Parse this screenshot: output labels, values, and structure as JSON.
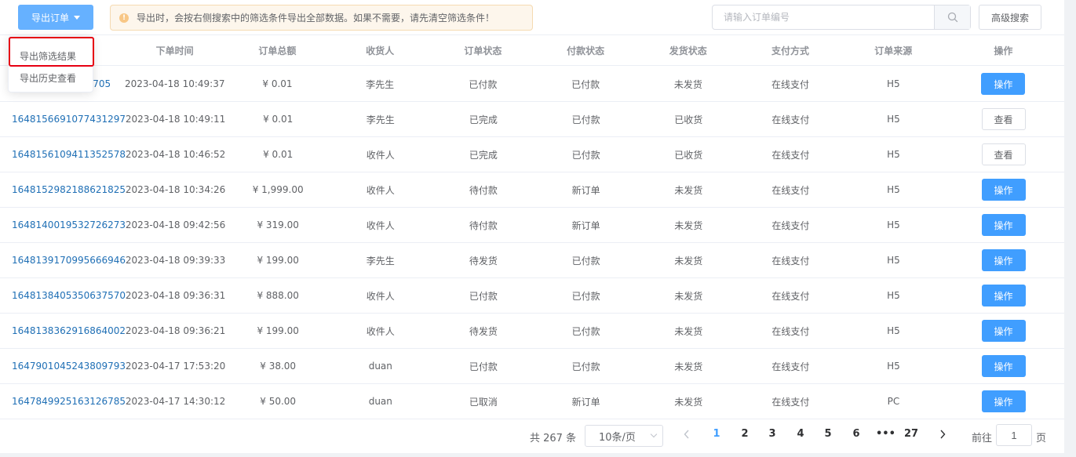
{
  "toolbar": {
    "export_label": "导出订单",
    "alert_icon": "!",
    "alert_text": "导出时，会按右侧搜索中的筛选条件导出全部数据。如果不需要，请先清空筛选条件！",
    "search_placeholder": "请输入订单编号",
    "search_value": "",
    "advanced_label": "高级搜索"
  },
  "dropdown": {
    "items": [
      {
        "label": "导出筛选结果"
      },
      {
        "label": "导出历史查看"
      }
    ],
    "highlight_color": "#e60012"
  },
  "table": {
    "headers": [
      "下单时间",
      "订单总额",
      "收货人",
      "订单状态",
      "付款状态",
      "发货状态",
      "支付方式",
      "订单来源",
      "操作"
    ],
    "rows": [
      {
        "order": "1648157...6705",
        "order_visible": "6705",
        "time": "2023-04-18 10:49:37",
        "amount": "¥ 0.01",
        "receiver": "李先生",
        "status": "已付款",
        "pay": "已付款",
        "ship": "未发货",
        "method": "在线支付",
        "source": "H5",
        "action": "操作"
      },
      {
        "order": "1648156691077431297",
        "time": "2023-04-18 10:49:11",
        "amount": "¥ 0.01",
        "receiver": "李先生",
        "status": "已完成",
        "pay": "已付款",
        "ship": "已收货",
        "method": "在线支付",
        "source": "H5",
        "action": "查看"
      },
      {
        "order": "1648156109411352578",
        "time": "2023-04-18 10:46:52",
        "amount": "¥ 0.01",
        "receiver": "收件人",
        "status": "已完成",
        "pay": "已付款",
        "ship": "已收货",
        "method": "在线支付",
        "source": "H5",
        "action": "查看"
      },
      {
        "order": "1648152982188621825",
        "time": "2023-04-18 10:34:26",
        "amount": "¥ 1,999.00",
        "receiver": "收件人",
        "status": "待付款",
        "pay": "新订单",
        "ship": "未发货",
        "method": "在线支付",
        "source": "H5",
        "action": "操作"
      },
      {
        "order": "1648140019532726273",
        "time": "2023-04-18 09:42:56",
        "amount": "¥ 319.00",
        "receiver": "收件人",
        "status": "待付款",
        "pay": "新订单",
        "ship": "未发货",
        "method": "在线支付",
        "source": "H5",
        "action": "操作"
      },
      {
        "order": "1648139170995666946",
        "time": "2023-04-18 09:39:33",
        "amount": "¥ 199.00",
        "receiver": "李先生",
        "status": "待发货",
        "pay": "已付款",
        "ship": "未发货",
        "method": "在线支付",
        "source": "H5",
        "action": "操作"
      },
      {
        "order": "1648138405350637570",
        "time": "2023-04-18 09:36:31",
        "amount": "¥ 888.00",
        "receiver": "收件人",
        "status": "已付款",
        "pay": "已付款",
        "ship": "未发货",
        "method": "在线支付",
        "source": "H5",
        "action": "操作"
      },
      {
        "order": "1648138362916864002",
        "time": "2023-04-18 09:36:21",
        "amount": "¥ 199.00",
        "receiver": "收件人",
        "status": "待发货",
        "pay": "已付款",
        "ship": "未发货",
        "method": "在线支付",
        "source": "H5",
        "action": "操作"
      },
      {
        "order": "1647901045243809793",
        "time": "2023-04-17 17:53:20",
        "amount": "¥ 38.00",
        "receiver": "duan",
        "status": "已付款",
        "pay": "已付款",
        "ship": "未发货",
        "method": "在线支付",
        "source": "H5",
        "action": "操作"
      },
      {
        "order": "1647849925163126785",
        "time": "2023-04-17 14:30:12",
        "amount": "¥ 50.00",
        "receiver": "duan",
        "status": "已取消",
        "pay": "新订单",
        "ship": "未发货",
        "method": "在线支付",
        "source": "PC",
        "action": "操作"
      }
    ]
  },
  "pagination": {
    "total": "共 267 条",
    "page_size": "10条/页",
    "pages": [
      "1",
      "2",
      "3",
      "4",
      "5",
      "6",
      "•••",
      "27"
    ],
    "current": "1",
    "goto_label": "前往",
    "goto_value": "1",
    "goto_suffix": "页"
  },
  "colors": {
    "primary": "#409eff",
    "export_button": "#66b1ff",
    "link": "#1f6fb5",
    "alert_bg": "#fdf6ec",
    "alert_icon": "#f8c786"
  },
  "icons": {
    "search": "search-icon",
    "caret": "caret-down-icon",
    "warning": "warning-icon",
    "prev": "chevron-left-icon",
    "next": "chevron-right-icon"
  }
}
